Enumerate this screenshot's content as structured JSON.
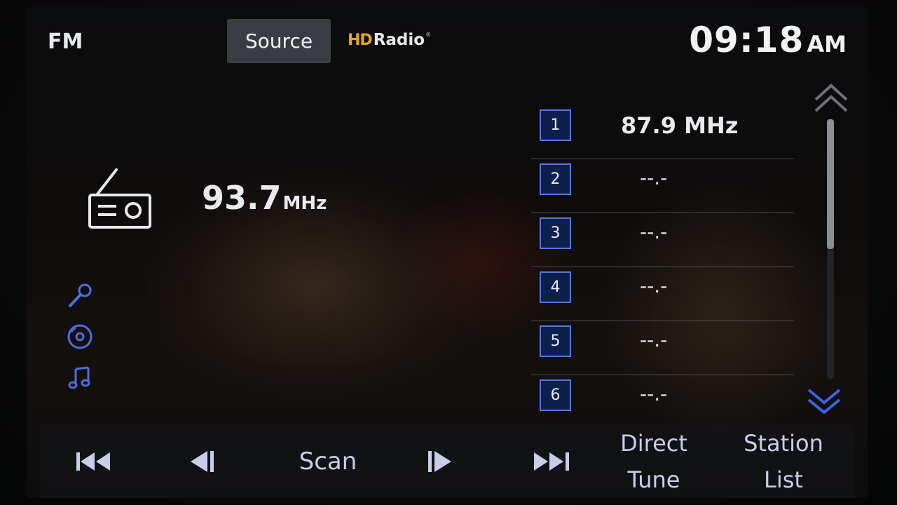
{
  "header": {
    "band": "FM",
    "source_label": "Source",
    "hd_logo": {
      "mark": "HD",
      "text": "Radio",
      "reg": "®"
    },
    "clock": {
      "time": "09:18",
      "ampm": "AM"
    }
  },
  "now_playing": {
    "frequency": "93.7",
    "unit": "MHz",
    "icon": "radio-icon"
  },
  "side_icons": [
    "microphone-icon",
    "disc-icon",
    "music-note-icon"
  ],
  "presets": [
    {
      "number": "1",
      "frequency": "87.9 MHz"
    },
    {
      "number": "2",
      "frequency": "--.-"
    },
    {
      "number": "3",
      "frequency": "--.-"
    },
    {
      "number": "4",
      "frequency": "--.-"
    },
    {
      "number": "5",
      "frequency": "--.-"
    },
    {
      "number": "6",
      "frequency": "--.-"
    }
  ],
  "bottom_bar": {
    "scan_label": "Scan",
    "direct_tune_line1": "Direct",
    "direct_tune_line2": "Tune",
    "station_list_line1": "Station",
    "station_list_line2": "List"
  },
  "colors": {
    "accent_blue": "#5a78d8",
    "hd_gold": "#e0a51c",
    "button_label": "#c8cdea"
  }
}
